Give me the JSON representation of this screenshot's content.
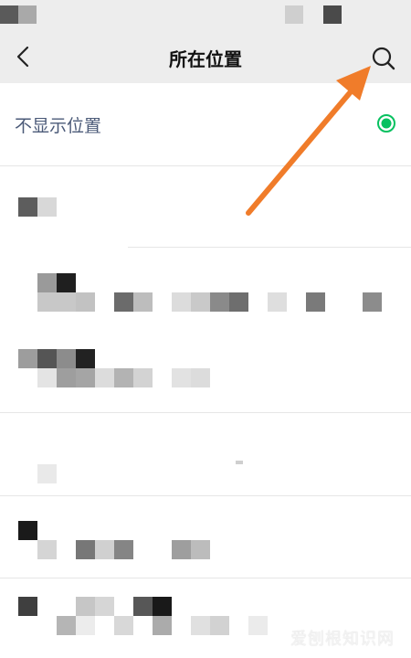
{
  "nav": {
    "title": "所在位置"
  },
  "hide_location": {
    "label": "不显示位置",
    "selected": true,
    "accent_color": "#07c160"
  },
  "icons": {
    "back": "chevron-left-icon",
    "search": "search-icon",
    "radio": "radio-checked-icon"
  },
  "annotation": {
    "arrow_color": "#f07c2a"
  },
  "watermark": "爱刨根知识网"
}
